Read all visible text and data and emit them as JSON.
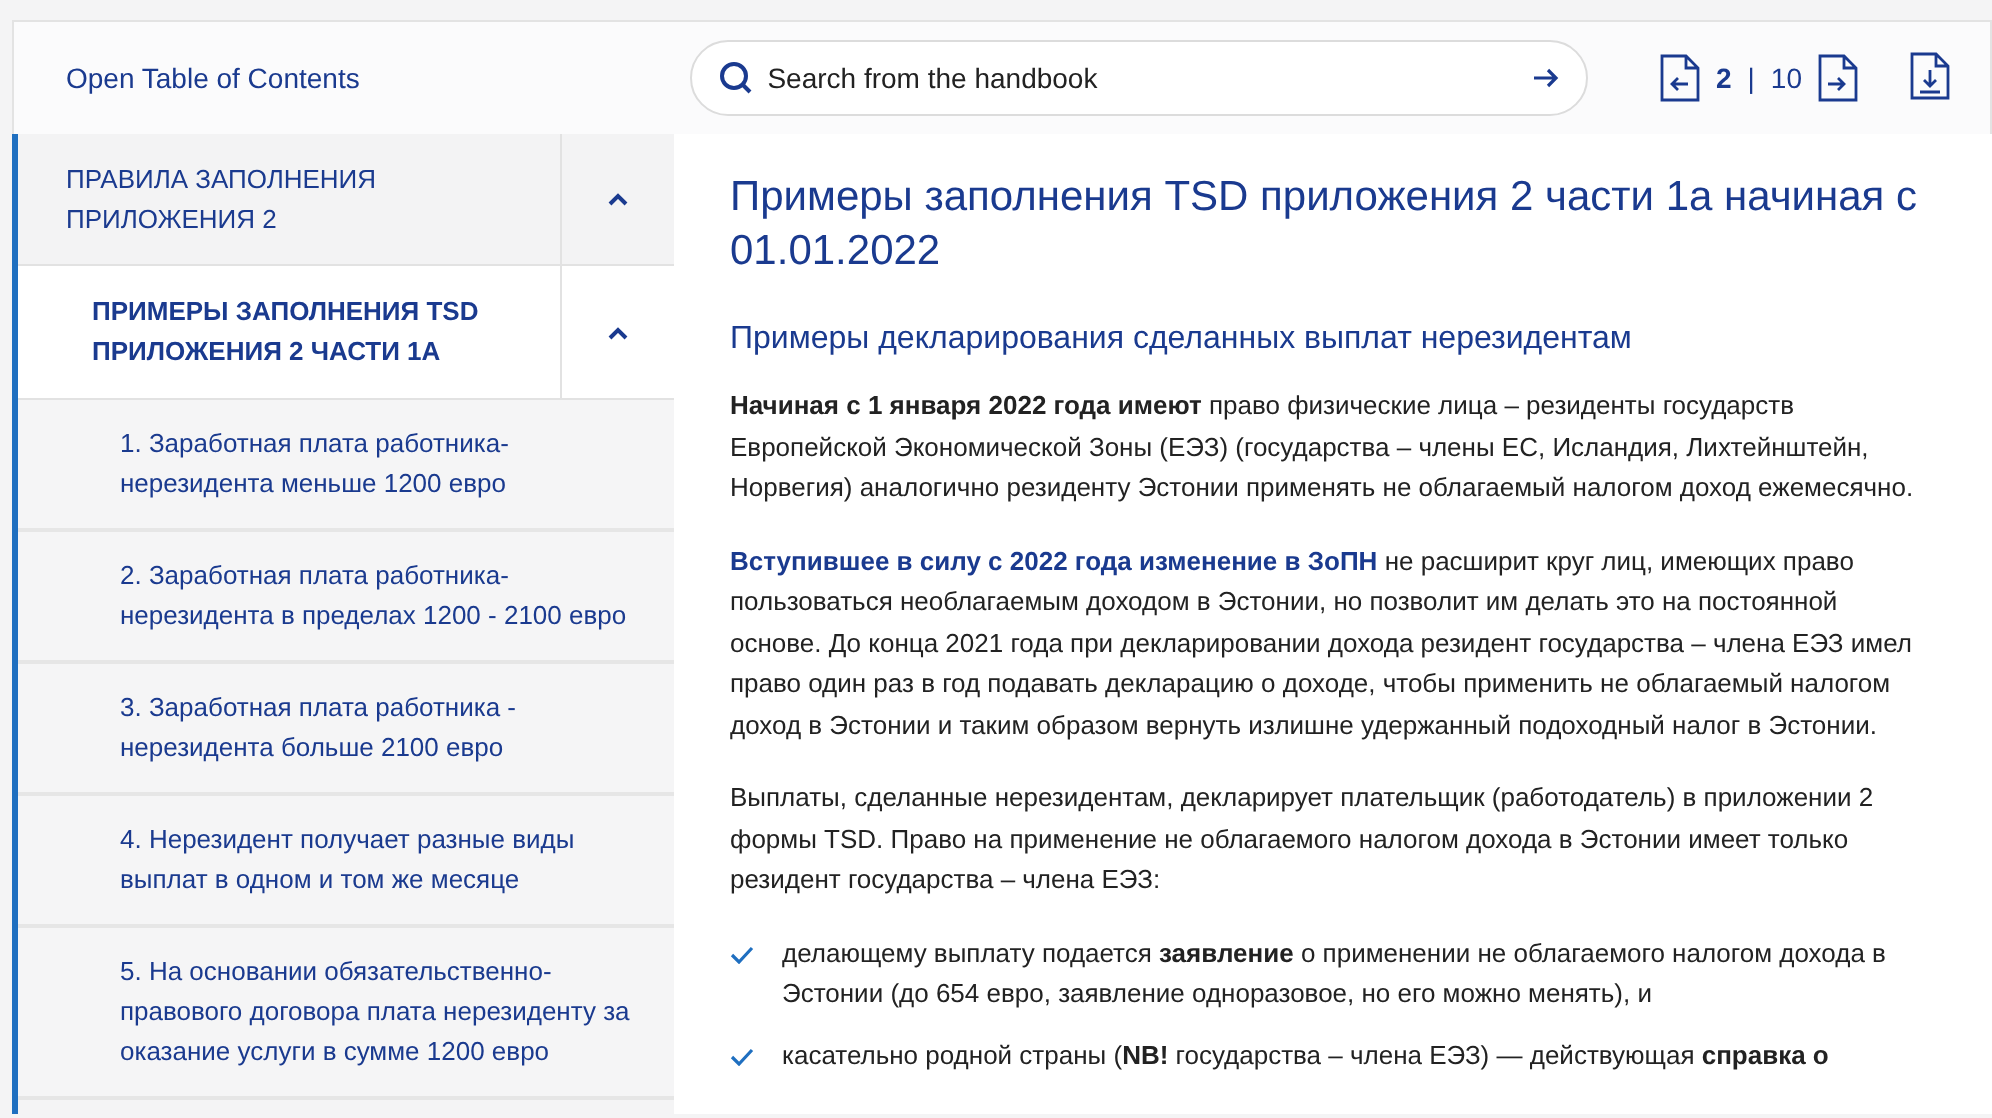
{
  "toolbar": {
    "toc_link": "Open Table of Contents",
    "search": {
      "placeholder": "Search from the handbook"
    },
    "page": {
      "current": "2",
      "separator": "|",
      "total": "10"
    }
  },
  "sidebar": {
    "items": [
      {
        "label": "ПРАВИЛА ЗАПОЛНЕНИЯ ПРИЛОЖЕНИЯ 2",
        "expanded": true,
        "children": [
          {
            "label": "ПРИМЕРЫ ЗАПОЛНЕНИЯ TSD ПРИЛОЖЕНИЯ 2 ЧАСТИ 1А",
            "expanded": true,
            "children": [
              {
                "label": "1. Заработная плата работника-нерезидента меньше 1200 евро"
              },
              {
                "label": "2. Заработная плата работника-нерезидента в пределах 1200 - 2100 евро"
              },
              {
                "label": "3. Заработная плата работника - нерезидента больше 2100 евро"
              },
              {
                "label": "4. Нерезидент получает разные виды выплат в одном и том же месяце"
              },
              {
                "label": "5. На основании обязательственно-правового договора плата нерезиденту за оказание услуги в сумме 1200 евро"
              }
            ]
          }
        ]
      }
    ]
  },
  "content": {
    "title": "Примеры заполнения TSD приложения 2 части 1а начиная с 01.01.2022",
    "subtitle": "Примеры декларирования сделанных выплат нерезидентам",
    "blocks": [
      {
        "kind": "paragraph",
        "text": "**Начиная с 1 января 2022 года имеют** право физические лица – резиденты государств Европейской Экономической Зоны (ЕЭЗ) (государства – члены ЕС, Исландия, Лихтейнштейн, Норвегия) аналогично резиденту Эстонии применять не облагаемый налогом доход ежемесячно."
      },
      {
        "kind": "paragraph",
        "link": "Вступившее в силу с 2022 года изменение в ЗоПН",
        "text": "не расширит круг лиц, имеющих право пользоваться необлагаемым доходом в Эстонии, но позволит им делать это на постоянной основе. До конца 2021 года при декларировании дохода резидент государства – члена ЕЭЗ имел право один раз в год подавать декларацию о доходе, чтобы применить не облагаемый налогом доход в Эстонии и таким образом вернуть излишне удержанный подоходный налог в Эстонии."
      },
      {
        "kind": "paragraph",
        "text": "Выплаты, сделанные нерезидентам, декларирует плательщик (работодатель) в приложении 2 формы TSD. Право на применение не облагаемого налогом дохода в Эстонии имеет только резидент государства – члена ЕЭЗ:"
      },
      {
        "kind": "check",
        "text": "делающему выплату подается **заявление** о применении не облагаемого налогом дохода в Эстонии (до 654 евро, заявление одноразовое, но его можно менять), и"
      },
      {
        "kind": "check",
        "text": "касательно родной страны (**NB!** государства – члена ЕЭЗ) — действующая **справка о**"
      }
    ]
  }
}
